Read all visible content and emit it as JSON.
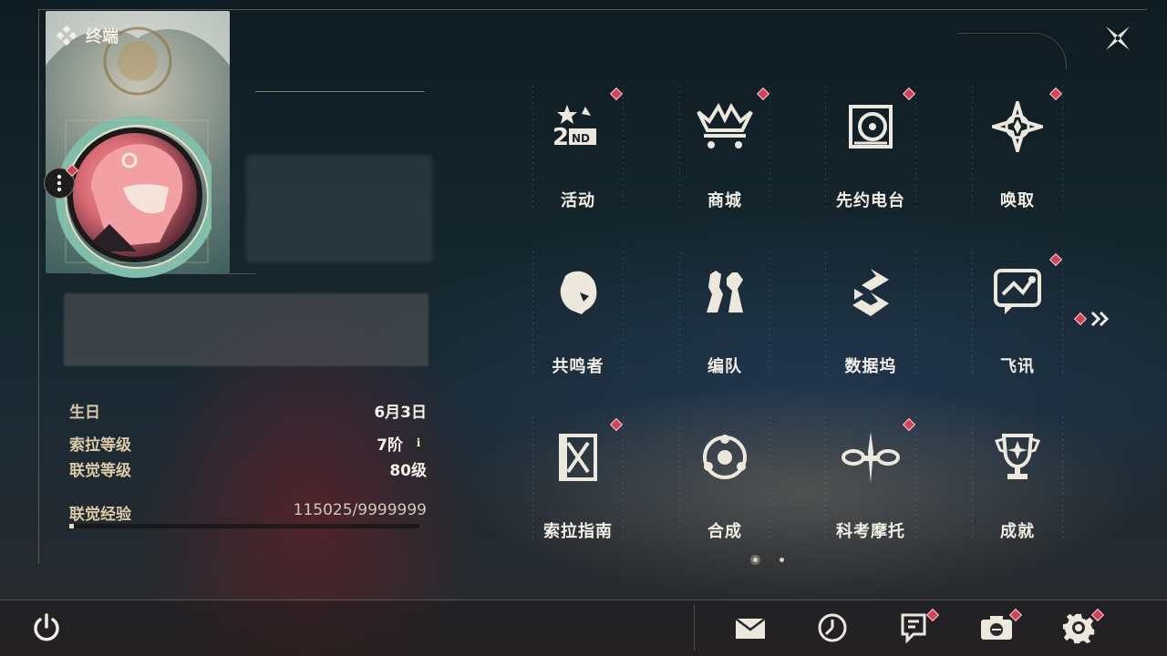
{
  "header": {
    "title": "终端"
  },
  "profile": {
    "birthday_label": "生日",
    "birthday_value": "6月3日",
    "sola_level_label": "索拉等级",
    "sola_level_value": "7阶",
    "union_level_label": "联觉等级",
    "union_level_value": "80级",
    "exp_label": "联觉经验",
    "exp_value": "115025/9999999",
    "exp_progress": 0.0115
  },
  "menu": {
    "page": 1,
    "page_count": 2,
    "items": [
      {
        "label": "活动",
        "icon": "event-2nd-icon",
        "badge": true
      },
      {
        "label": "商城",
        "icon": "shop-crown-icon",
        "badge": true
      },
      {
        "label": "先约电台",
        "icon": "radio-record-icon",
        "badge": true
      },
      {
        "label": "唤取",
        "icon": "convene-star-icon",
        "badge": true
      },
      {
        "label": "共鸣者",
        "icon": "resonator-head-icon",
        "badge": false
      },
      {
        "label": "编队",
        "icon": "chess-team-icon",
        "badge": false
      },
      {
        "label": "数据坞",
        "icon": "databank-icon",
        "badge": false
      },
      {
        "label": "飞讯",
        "icon": "chat-message-icon",
        "badge": true
      },
      {
        "label": "索拉指南",
        "icon": "guidebook-icon",
        "badge": true
      },
      {
        "label": "合成",
        "icon": "synthesis-icon",
        "badge": false
      },
      {
        "label": "科考摩托",
        "icon": "motorbike-icon",
        "badge": true
      },
      {
        "label": "成就",
        "icon": "trophy-icon",
        "badge": false
      }
    ]
  },
  "bottom_bar": [
    {
      "name": "mail",
      "icon": "mail-icon",
      "badge": false
    },
    {
      "name": "clock",
      "icon": "clock-icon",
      "badge": false
    },
    {
      "name": "notice",
      "icon": "notice-icon",
      "badge": true
    },
    {
      "name": "camera",
      "icon": "camera-icon",
      "badge": true
    },
    {
      "name": "settings",
      "icon": "gear-icon",
      "badge": true
    }
  ],
  "colors": {
    "badge": "#d84055",
    "label_gold": "#d9c9a6",
    "text": "#f2eee4"
  }
}
